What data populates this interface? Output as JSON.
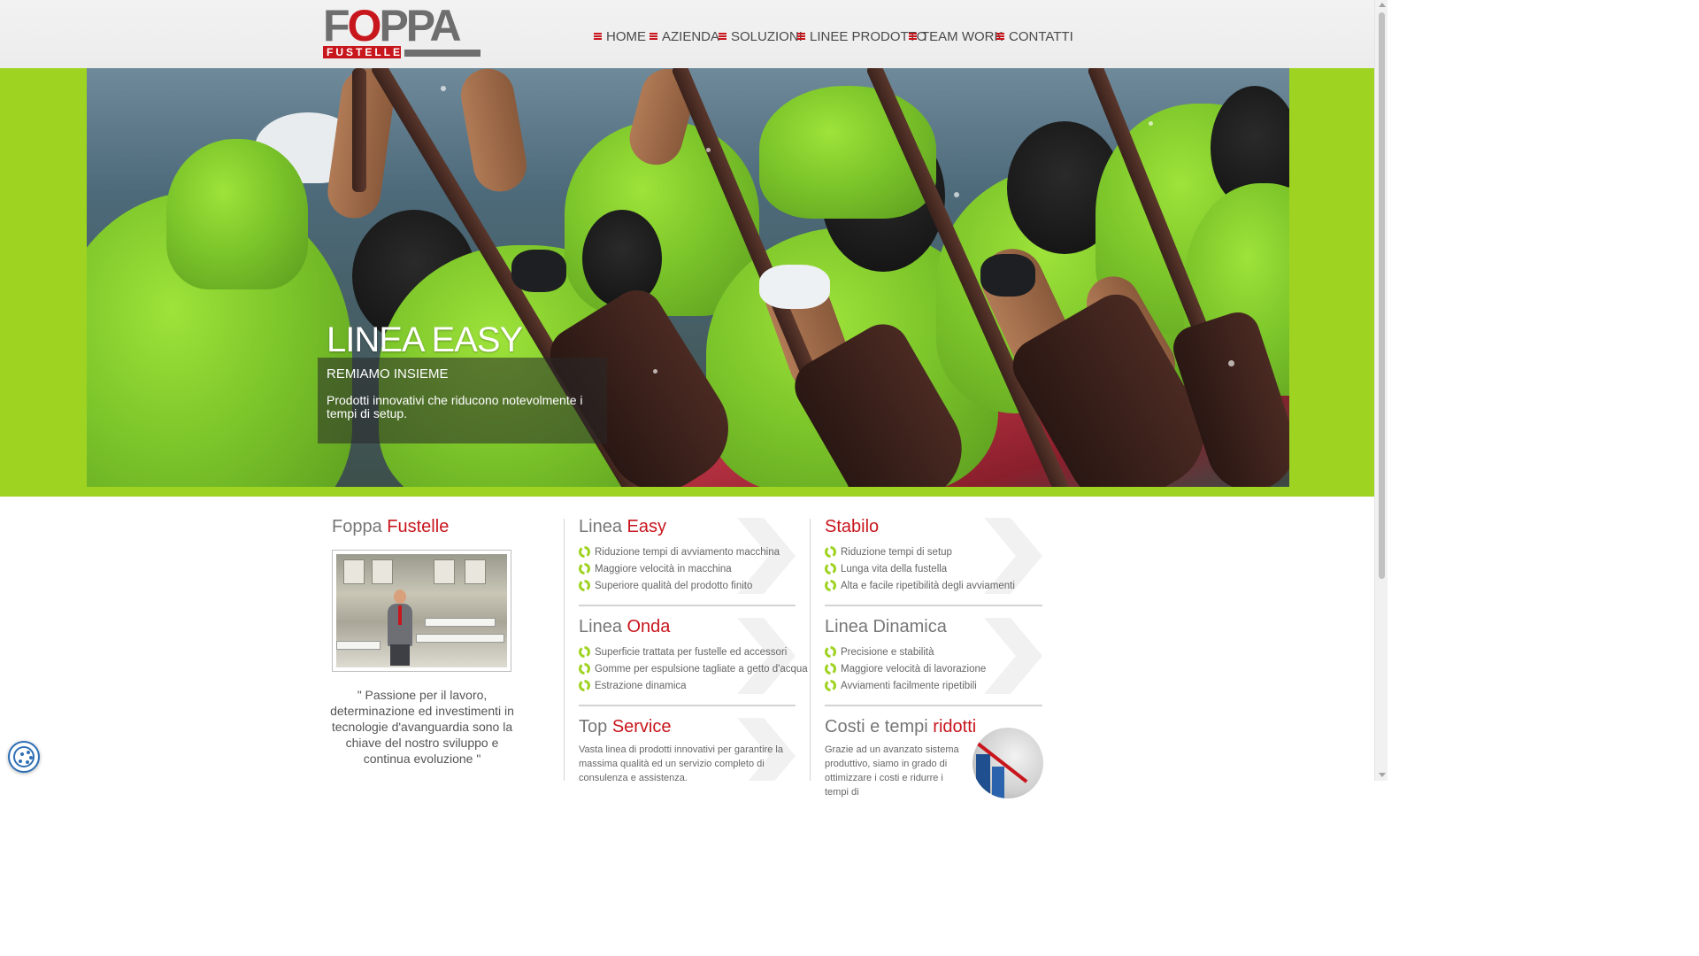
{
  "header": {
    "logo": {
      "main": "FOPPA",
      "sub": "FUSTELLE"
    },
    "nav": [
      {
        "label": "HOME"
      },
      {
        "label": "AZIENDA"
      },
      {
        "label": "SOLUZIONI"
      },
      {
        "label": "LINEE PRODOTTO"
      },
      {
        "label": "TEAM WORK"
      },
      {
        "label": "CONTATTI"
      }
    ],
    "nav_icon": "menu-lines-icon",
    "accent_color": "#c8161d"
  },
  "hero": {
    "title": "LINEA EASY",
    "subtitle": "REMIAMO INSIEME",
    "text": "Prodotti innovativi che riducono notevolmente i tempi di setup.",
    "band_color": "#9fd321"
  },
  "about": {
    "title_plain": "Foppa",
    "title_accent": "Fustelle",
    "quote": "\" Passione per il lavoro, determinazione ed investimenti in tecnologie d'avanguardia sono la chiave del nostro sviluppo e continua evoluzione \""
  },
  "products": {
    "linea_easy": {
      "title_plain": "Linea",
      "title_accent": "Easy",
      "items": [
        "Riduzione tempi di avviamento macchina",
        "Maggiore velocità in macchina",
        "Superiore qualità del prodotto finito"
      ]
    },
    "stabilo": {
      "title_plain": "",
      "title_accent": "Stabilo",
      "items": [
        "Riduzione tempi di setup",
        "Lunga vita della fustella",
        "Alta e facile ripetibilità degli avviamenti"
      ]
    },
    "linea_onda": {
      "title_plain": "Linea",
      "title_accent": "Onda",
      "items": [
        "Superficie trattata per fustelle ed accessori",
        "Gomme per espulsione tagliate a getto d'acqua",
        "Estrazione dinamica"
      ]
    },
    "linea_dinamica": {
      "title_plain": "Linea Dinamica",
      "title_accent": "",
      "items": [
        "Precisione e stabilità",
        "Maggiore velocità di lavorazione",
        "Avviamenti facilmente ripetibili"
      ]
    },
    "top_service": {
      "title_plain": "Top",
      "title_accent": "Service",
      "text": "Vasta linea di prodotti innovativi per garantire la massima qualità ed un servizio completo di consulenza e assistenza."
    },
    "costi": {
      "title_plain": "Costi e tempi",
      "title_accent": "ridotti",
      "text": "Grazie ad un avanzato sistema produttivo, siamo in grado di ottimizzare i costi e ridurre i tempi di"
    }
  },
  "icons": {
    "bullet": "green-cycle-icon",
    "chevron": "chevron-right-icon",
    "cookie": "cookie-icon"
  }
}
